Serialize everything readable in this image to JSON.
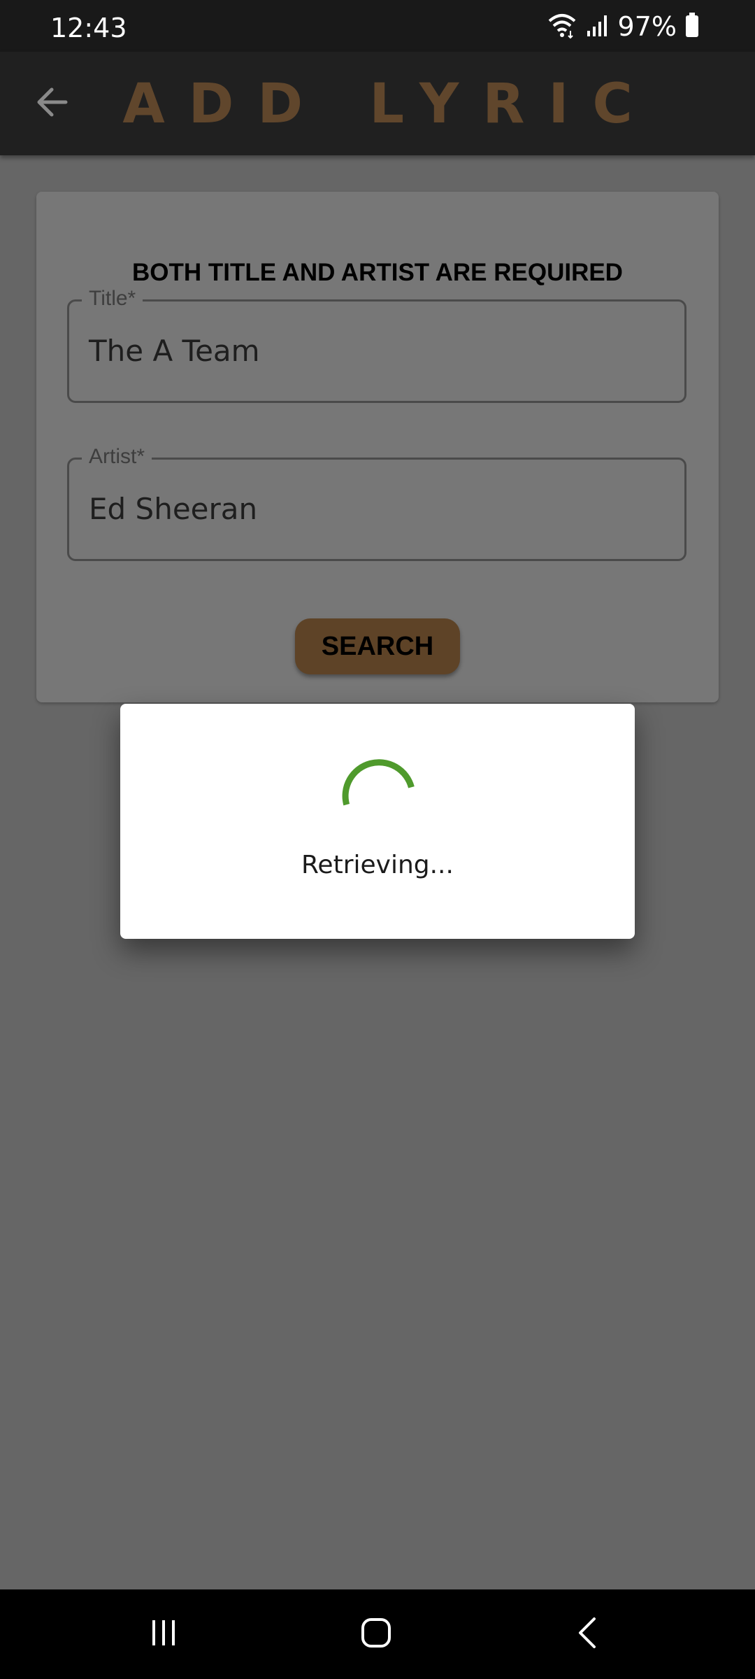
{
  "status_bar": {
    "time": "12:43",
    "battery": "97%",
    "icons": [
      "wifi-icon",
      "signal-icon",
      "battery-icon"
    ]
  },
  "app_bar": {
    "title": "ADD LYRIC",
    "back_icon": "arrow-left-icon",
    "title_color": "#60462c"
  },
  "form": {
    "heading": "BOTH TITLE AND ARTIST ARE REQUIRED",
    "title_field": {
      "label": "Title*",
      "value": "The A Team"
    },
    "artist_field": {
      "label": "Artist*",
      "value": "Ed Sheeran"
    },
    "search_label": "SEARCH",
    "button_color": "#5e4327"
  },
  "dialog": {
    "message": "Retrieving...",
    "spinner_color": "#4f9a2c"
  },
  "nav_bar": {
    "icons": [
      "recent-apps-icon",
      "home-icon",
      "back-icon"
    ]
  }
}
